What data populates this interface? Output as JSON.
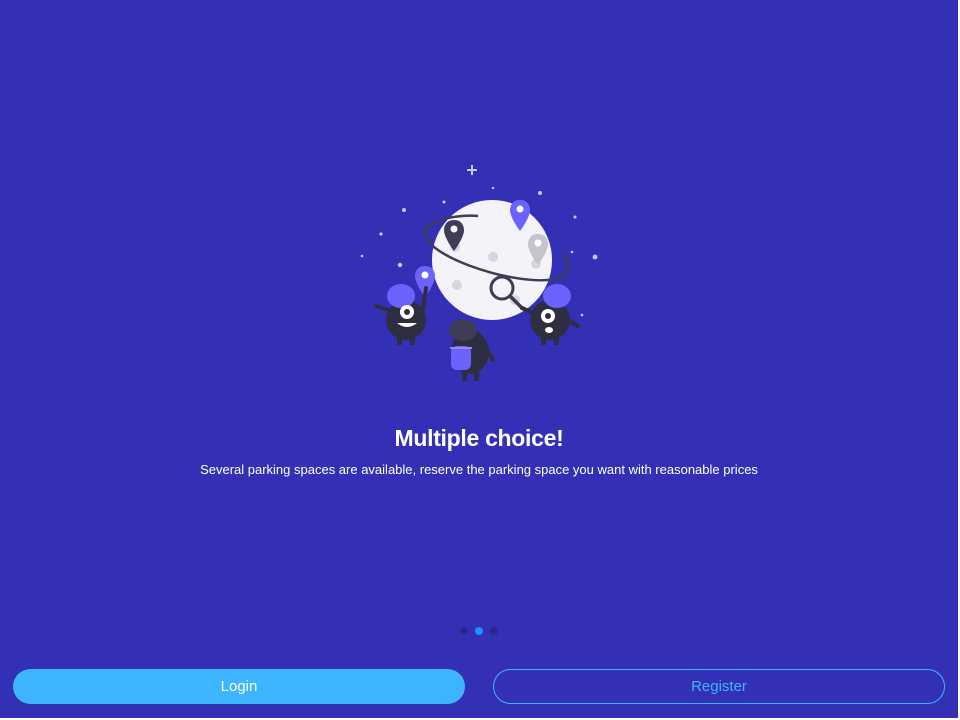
{
  "onboarding": {
    "title": "Multiple choice!",
    "description": "Several parking spaces are available, reserve the parking space you want with reasonable prices",
    "illustration_icon": "moon-with-map-pins-illustration",
    "pager": {
      "total": 3,
      "active_index": 1
    }
  },
  "actions": {
    "login_label": "Login",
    "register_label": "Register"
  },
  "colors": {
    "background": "#3430b6",
    "accent": "#3db5fe",
    "dot_inactive": "#27278f",
    "dot_active": "#1e90ff"
  }
}
